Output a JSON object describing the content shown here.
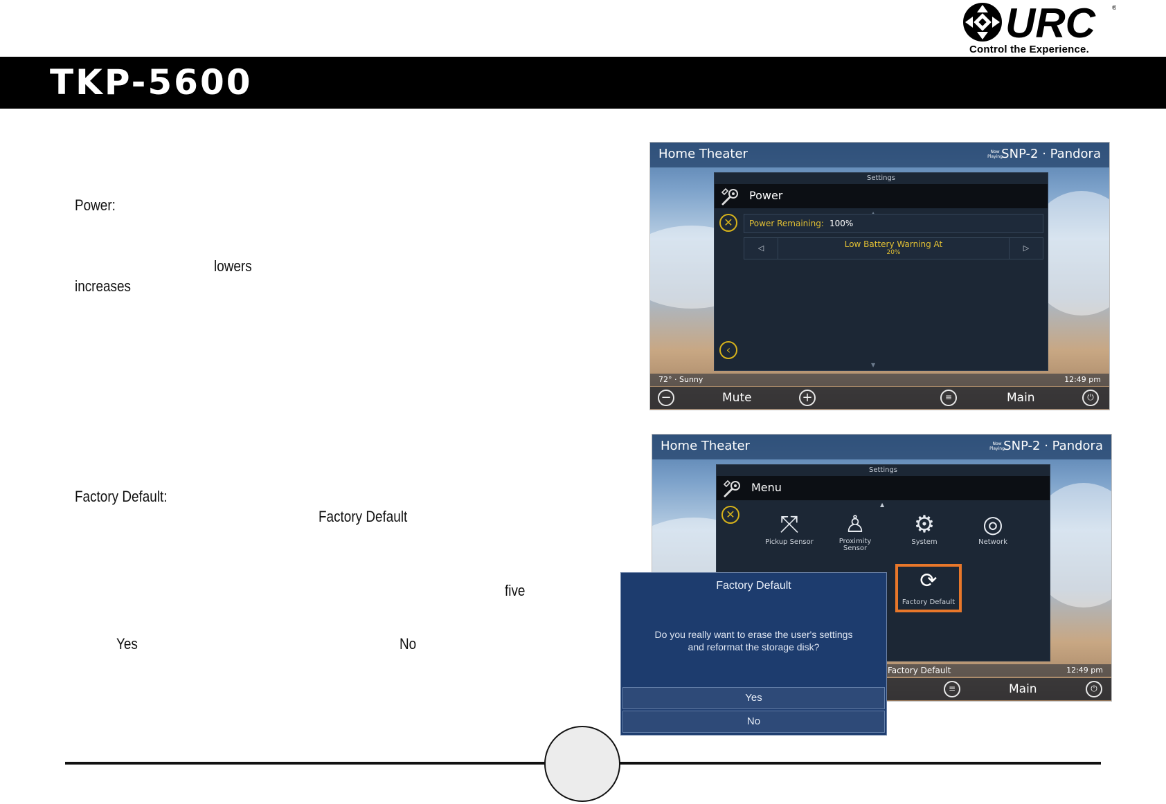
{
  "header": {
    "brand_tagline": "Control the Experience.",
    "brand_logo_text": "URC",
    "product_title": "TKP-5600"
  },
  "body_text": {
    "power_heading": "Power:",
    "power_word_lowers": "lowers",
    "power_word_increases": "increases",
    "factory_heading": "Factory Default:",
    "factory_word_factory_default": "Factory Default",
    "factory_word_five": "five",
    "factory_word_yes": "Yes",
    "factory_word_no": "No"
  },
  "screen1": {
    "room": "Home Theater",
    "now_playing": "Now Playing",
    "source": "SNP-2 · Pandora",
    "panel_caption": "Settings",
    "panel_title": "Power",
    "power_remaining_label": "Power Remaining:",
    "power_remaining_value": "100%",
    "low_battery_label": "Low Battery Warning At",
    "low_battery_value": "20%",
    "weather": "72° · Sunny",
    "time": "12:49 pm",
    "mute_label": "Mute",
    "main_label": "Main"
  },
  "screen2": {
    "room": "Home Theater",
    "now_playing": "Now Playing",
    "source": "SNP-2 · Pandora",
    "panel_caption": "Settings",
    "panel_title": "Menu",
    "menu_items": [
      "Pickup Sensor",
      "Proximity Sensor",
      "System",
      "Network"
    ],
    "factory_default_label": "Factory Default",
    "status_label": "Factory Default",
    "time": "12:49 pm",
    "main_label": "Main"
  },
  "dialog": {
    "title": "Factory Default",
    "message_line1": "Do you really want to erase the user's settings",
    "message_line2": "and reformat the storage disk?",
    "yes_label": "Yes",
    "no_label": "No"
  },
  "colors": {
    "accent_yellow": "#e2c034",
    "highlight_orange": "#e8772a",
    "title_bar": "#000000",
    "dialog_blue": "#1d3c6e"
  }
}
